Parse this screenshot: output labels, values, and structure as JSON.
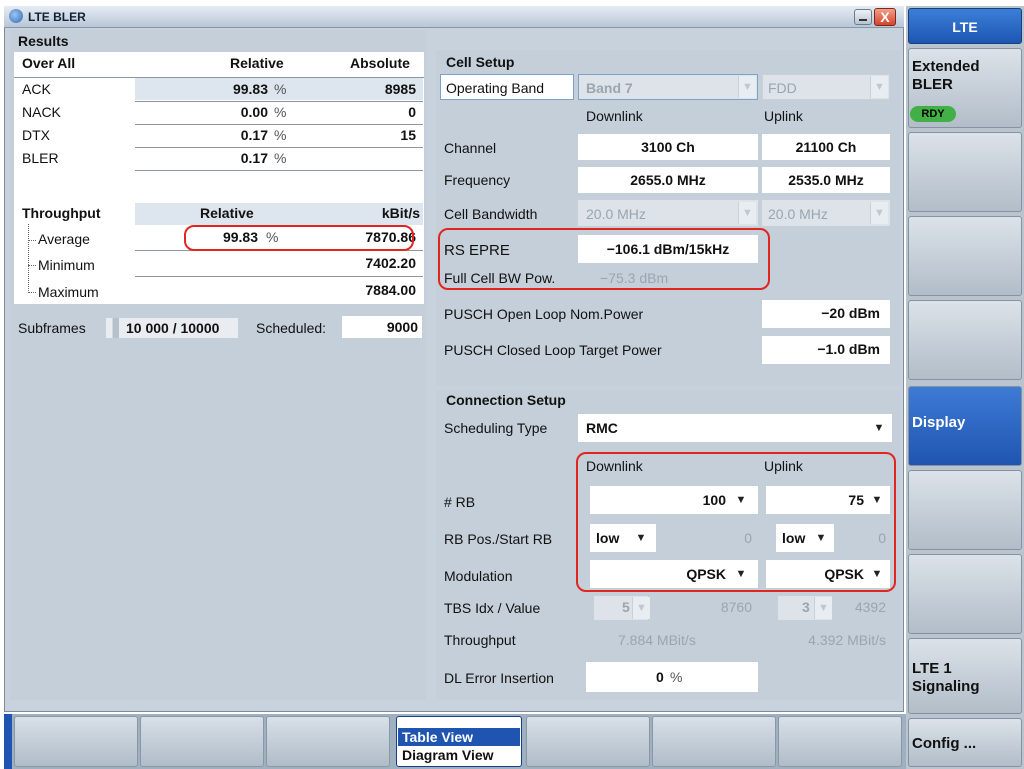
{
  "window": {
    "title": "LTE BLER",
    "close_glyph": "X"
  },
  "results": {
    "heading": "Results",
    "table": {
      "headers": [
        "Over All",
        "Relative",
        "Absolute"
      ],
      "rows": [
        {
          "label": "ACK",
          "relative": "99.83",
          "unit": "%",
          "absolute": "8985"
        },
        {
          "label": "NACK",
          "relative": "0.00",
          "unit": "%",
          "absolute": "0"
        },
        {
          "label": "DTX",
          "relative": "0.17",
          "unit": "%",
          "absolute": "15"
        },
        {
          "label": "BLER",
          "relative": "0.17",
          "unit": "%",
          "absolute": ""
        }
      ]
    },
    "throughput": {
      "headers": [
        "Throughput",
        "Relative",
        "kBit/s"
      ],
      "rows": [
        {
          "label": "Average",
          "relative": "99.83",
          "unit": "%",
          "value": "7870.86"
        },
        {
          "label": "Minimum",
          "relative": "",
          "unit": "",
          "value": "7402.20"
        },
        {
          "label": "Maximum",
          "relative": "",
          "unit": "",
          "value": "7884.00"
        }
      ]
    },
    "subframes_label": "Subframes",
    "subframes_value": "10 000 / 10000",
    "scheduled_label": "Scheduled:",
    "scheduled_value": "9000"
  },
  "cell_setup": {
    "heading": "Cell Setup",
    "operating_band_label": "Operating Band",
    "operating_band_value": "Band 7",
    "duplex_value": "FDD",
    "downlink_label": "Downlink",
    "uplink_label": "Uplink",
    "channel_label": "Channel",
    "channel_dl": "3100  Ch",
    "channel_ul": "21100  Ch",
    "frequency_label": "Frequency",
    "frequency_dl": "2655.0  MHz",
    "frequency_ul": "2535.0  MHz",
    "bandwidth_label": "Cell Bandwidth",
    "bandwidth_dl": "20.0 MHz",
    "bandwidth_ul": "20.0 MHz",
    "rs_epre_label": "RS EPRE",
    "rs_epre_value": "−106.1  dBm/15kHz",
    "full_cell_label": "Full Cell BW Pow.",
    "full_cell_value": "−75.3  dBm",
    "pusch_open_label": "PUSCH Open Loop Nom.Power",
    "pusch_open_value": "−20  dBm",
    "pusch_closed_label": "PUSCH Closed Loop Target Power",
    "pusch_closed_value": "−1.0  dBm"
  },
  "connection_setup": {
    "heading": "Connection Setup",
    "scheduling_label": "Scheduling Type",
    "scheduling_value": "RMC",
    "downlink_label": "Downlink",
    "uplink_label": "Uplink",
    "rb_label": "# RB",
    "rb_dl": "100",
    "rb_ul": "75",
    "rbpos_label": "RB Pos./Start RB",
    "rbpos_dl": "low",
    "rbstart_dl": "0",
    "rbpos_ul": "low",
    "rbstart_ul": "0",
    "modulation_label": "Modulation",
    "modulation_dl": "QPSK",
    "modulation_ul": "QPSK",
    "tbs_label": "TBS Idx / Value",
    "tbs_idx_dl": "5",
    "tbs_value_dl": "8760",
    "tbs_idx_ul": "3",
    "tbs_value_ul": "4392",
    "throughput_label": "Throughput",
    "throughput_dl": "7.884  MBit/s",
    "throughput_ul": "4.392  MBit/s",
    "dl_error_label": "DL Error Insertion",
    "dl_error_value": "0",
    "dl_error_unit": "%"
  },
  "sidebar": {
    "header": "LTE",
    "items": [
      {
        "label": "Extended\nBLER",
        "badge": "RDY"
      },
      {
        "label": ""
      },
      {
        "label": ""
      },
      {
        "label": ""
      },
      {
        "label": "Display",
        "active": true
      },
      {
        "label": ""
      },
      {
        "label": ""
      },
      {
        "label": "LTE 1\nSignaling"
      },
      {
        "label": "Config ..."
      }
    ]
  },
  "bottom_bar": {
    "buttons": [
      "",
      "",
      "",
      "Table View",
      "",
      "",
      ""
    ],
    "active_sub": "Diagram View"
  },
  "icons": {
    "dropdown": "chevron-down-icon",
    "minimize": "minimize-icon",
    "close": "close-icon"
  },
  "colors": {
    "highlight_oval": "#e0261f",
    "accent": "#1f55b0",
    "rdy_badge": "#42b046"
  }
}
